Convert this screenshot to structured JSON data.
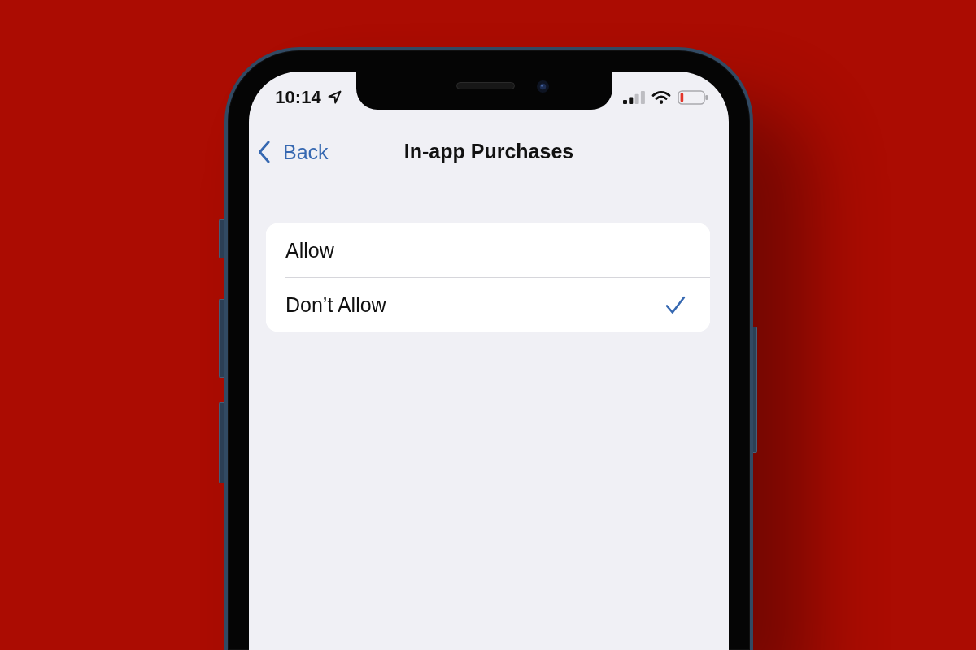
{
  "status_bar": {
    "time": "10:14"
  },
  "nav_bar": {
    "back_label": "Back",
    "title": "In-app Purchases"
  },
  "options": [
    {
      "label": "Allow",
      "selected": false
    },
    {
      "label": "Don’t Allow",
      "selected": true
    }
  ]
}
